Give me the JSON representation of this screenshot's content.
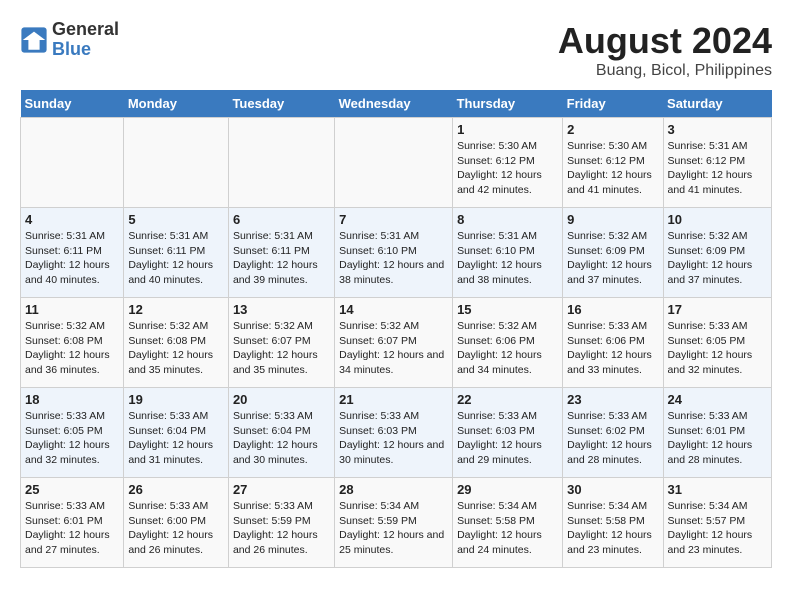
{
  "header": {
    "logo_general": "General",
    "logo_blue": "Blue",
    "title": "August 2024",
    "subtitle": "Buang, Bicol, Philippines"
  },
  "weekdays": [
    "Sunday",
    "Monday",
    "Tuesday",
    "Wednesday",
    "Thursday",
    "Friday",
    "Saturday"
  ],
  "weeks": [
    [
      {
        "day": "",
        "sunrise": "",
        "sunset": "",
        "daylight": ""
      },
      {
        "day": "",
        "sunrise": "",
        "sunset": "",
        "daylight": ""
      },
      {
        "day": "",
        "sunrise": "",
        "sunset": "",
        "daylight": ""
      },
      {
        "day": "",
        "sunrise": "",
        "sunset": "",
        "daylight": ""
      },
      {
        "day": "1",
        "sunrise": "5:30 AM",
        "sunset": "6:12 PM",
        "daylight": "12 hours and 42 minutes."
      },
      {
        "day": "2",
        "sunrise": "5:30 AM",
        "sunset": "6:12 PM",
        "daylight": "12 hours and 41 minutes."
      },
      {
        "day": "3",
        "sunrise": "5:31 AM",
        "sunset": "6:12 PM",
        "daylight": "12 hours and 41 minutes."
      }
    ],
    [
      {
        "day": "4",
        "sunrise": "5:31 AM",
        "sunset": "6:11 PM",
        "daylight": "12 hours and 40 minutes."
      },
      {
        "day": "5",
        "sunrise": "5:31 AM",
        "sunset": "6:11 PM",
        "daylight": "12 hours and 40 minutes."
      },
      {
        "day": "6",
        "sunrise": "5:31 AM",
        "sunset": "6:11 PM",
        "daylight": "12 hours and 39 minutes."
      },
      {
        "day": "7",
        "sunrise": "5:31 AM",
        "sunset": "6:10 PM",
        "daylight": "12 hours and 38 minutes."
      },
      {
        "day": "8",
        "sunrise": "5:31 AM",
        "sunset": "6:10 PM",
        "daylight": "12 hours and 38 minutes."
      },
      {
        "day": "9",
        "sunrise": "5:32 AM",
        "sunset": "6:09 PM",
        "daylight": "12 hours and 37 minutes."
      },
      {
        "day": "10",
        "sunrise": "5:32 AM",
        "sunset": "6:09 PM",
        "daylight": "12 hours and 37 minutes."
      }
    ],
    [
      {
        "day": "11",
        "sunrise": "5:32 AM",
        "sunset": "6:08 PM",
        "daylight": "12 hours and 36 minutes."
      },
      {
        "day": "12",
        "sunrise": "5:32 AM",
        "sunset": "6:08 PM",
        "daylight": "12 hours and 35 minutes."
      },
      {
        "day": "13",
        "sunrise": "5:32 AM",
        "sunset": "6:07 PM",
        "daylight": "12 hours and 35 minutes."
      },
      {
        "day": "14",
        "sunrise": "5:32 AM",
        "sunset": "6:07 PM",
        "daylight": "12 hours and 34 minutes."
      },
      {
        "day": "15",
        "sunrise": "5:32 AM",
        "sunset": "6:06 PM",
        "daylight": "12 hours and 34 minutes."
      },
      {
        "day": "16",
        "sunrise": "5:33 AM",
        "sunset": "6:06 PM",
        "daylight": "12 hours and 33 minutes."
      },
      {
        "day": "17",
        "sunrise": "5:33 AM",
        "sunset": "6:05 PM",
        "daylight": "12 hours and 32 minutes."
      }
    ],
    [
      {
        "day": "18",
        "sunrise": "5:33 AM",
        "sunset": "6:05 PM",
        "daylight": "12 hours and 32 minutes."
      },
      {
        "day": "19",
        "sunrise": "5:33 AM",
        "sunset": "6:04 PM",
        "daylight": "12 hours and 31 minutes."
      },
      {
        "day": "20",
        "sunrise": "5:33 AM",
        "sunset": "6:04 PM",
        "daylight": "12 hours and 30 minutes."
      },
      {
        "day": "21",
        "sunrise": "5:33 AM",
        "sunset": "6:03 PM",
        "daylight": "12 hours and 30 minutes."
      },
      {
        "day": "22",
        "sunrise": "5:33 AM",
        "sunset": "6:03 PM",
        "daylight": "12 hours and 29 minutes."
      },
      {
        "day": "23",
        "sunrise": "5:33 AM",
        "sunset": "6:02 PM",
        "daylight": "12 hours and 28 minutes."
      },
      {
        "day": "24",
        "sunrise": "5:33 AM",
        "sunset": "6:01 PM",
        "daylight": "12 hours and 28 minutes."
      }
    ],
    [
      {
        "day": "25",
        "sunrise": "5:33 AM",
        "sunset": "6:01 PM",
        "daylight": "12 hours and 27 minutes."
      },
      {
        "day": "26",
        "sunrise": "5:33 AM",
        "sunset": "6:00 PM",
        "daylight": "12 hours and 26 minutes."
      },
      {
        "day": "27",
        "sunrise": "5:33 AM",
        "sunset": "5:59 PM",
        "daylight": "12 hours and 26 minutes."
      },
      {
        "day": "28",
        "sunrise": "5:34 AM",
        "sunset": "5:59 PM",
        "daylight": "12 hours and 25 minutes."
      },
      {
        "day": "29",
        "sunrise": "5:34 AM",
        "sunset": "5:58 PM",
        "daylight": "12 hours and 24 minutes."
      },
      {
        "day": "30",
        "sunrise": "5:34 AM",
        "sunset": "5:58 PM",
        "daylight": "12 hours and 23 minutes."
      },
      {
        "day": "31",
        "sunrise": "5:34 AM",
        "sunset": "5:57 PM",
        "daylight": "12 hours and 23 minutes."
      }
    ]
  ],
  "labels": {
    "sunrise_prefix": "Sunrise: ",
    "sunset_prefix": "Sunset: ",
    "daylight_prefix": "Daylight: "
  }
}
